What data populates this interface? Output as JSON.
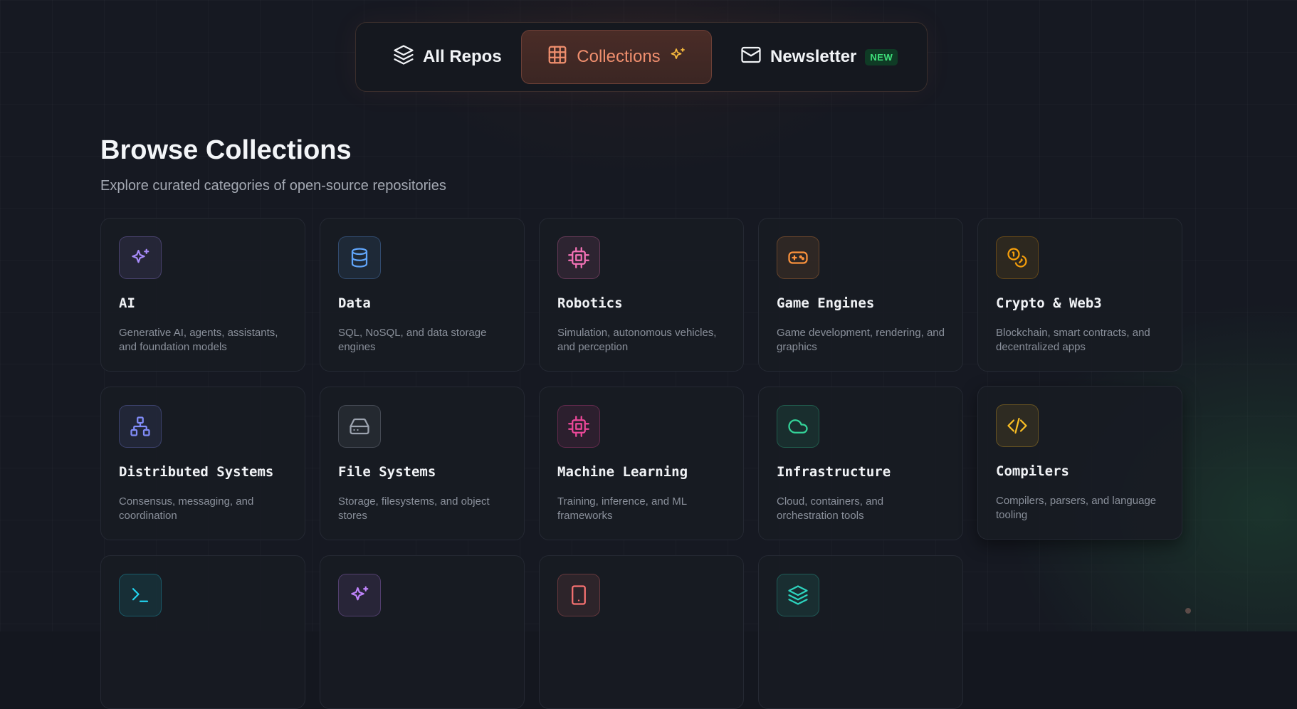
{
  "nav": {
    "tabs": [
      {
        "label": "All Repos",
        "icon": "layers-icon"
      },
      {
        "label": "Collections",
        "icon": "grid-icon",
        "active": true,
        "trailing_icon": "sparkles-icon"
      },
      {
        "label": "Newsletter",
        "icon": "mail-icon",
        "badge": "NEW"
      }
    ]
  },
  "page": {
    "title": "Browse Collections",
    "subtitle": "Explore curated categories of open-source repositories"
  },
  "collections": [
    {
      "name": "AI",
      "description": "Generative AI, agents, assistants, and foundation models",
      "icon": "sparkles-icon",
      "color": "#a78bfa"
    },
    {
      "name": "Data",
      "description": "SQL, NoSQL, and data storage engines",
      "icon": "database-icon",
      "color": "#60a5fa"
    },
    {
      "name": "Robotics",
      "description": "Simulation, autonomous vehicles, and perception",
      "icon": "cpu-icon",
      "color": "#f472b6"
    },
    {
      "name": "Game Engines",
      "description": "Game development, rendering, and graphics",
      "icon": "gamepad-icon",
      "color": "#fb923c"
    },
    {
      "name": "Crypto & Web3",
      "description": "Blockchain, smart contracts, and decentralized apps",
      "icon": "coins-icon",
      "color": "#f59e0b"
    },
    {
      "name": "Distributed Systems",
      "description": "Consensus, messaging, and coordination",
      "icon": "network-icon",
      "color": "#818cf8"
    },
    {
      "name": "File Systems",
      "description": "Storage, filesystems, and object stores",
      "icon": "hard-drive-icon",
      "color": "#9ca3af"
    },
    {
      "name": "Machine Learning",
      "description": "Training, inference, and ML frameworks",
      "icon": "cpu-icon",
      "color": "#ec4899"
    },
    {
      "name": "Infrastructure",
      "description": "Cloud, containers, and orchestration tools",
      "icon": "cloud-icon",
      "color": "#34d399"
    },
    {
      "name": "Compilers",
      "description": "Compilers, parsers, and language tooling",
      "icon": "code-icon",
      "color": "#fbbf24"
    },
    {
      "name": "",
      "description": "",
      "icon": "terminal-icon",
      "color": "#22d3ee"
    },
    {
      "name": "",
      "description": "",
      "icon": "sparkles-icon",
      "color": "#c084fc"
    },
    {
      "name": "",
      "description": "",
      "icon": "smartphone-icon",
      "color": "#f87171"
    },
    {
      "name": "",
      "description": "",
      "icon": "layers-icon",
      "color": "#2dd4bf"
    }
  ]
}
